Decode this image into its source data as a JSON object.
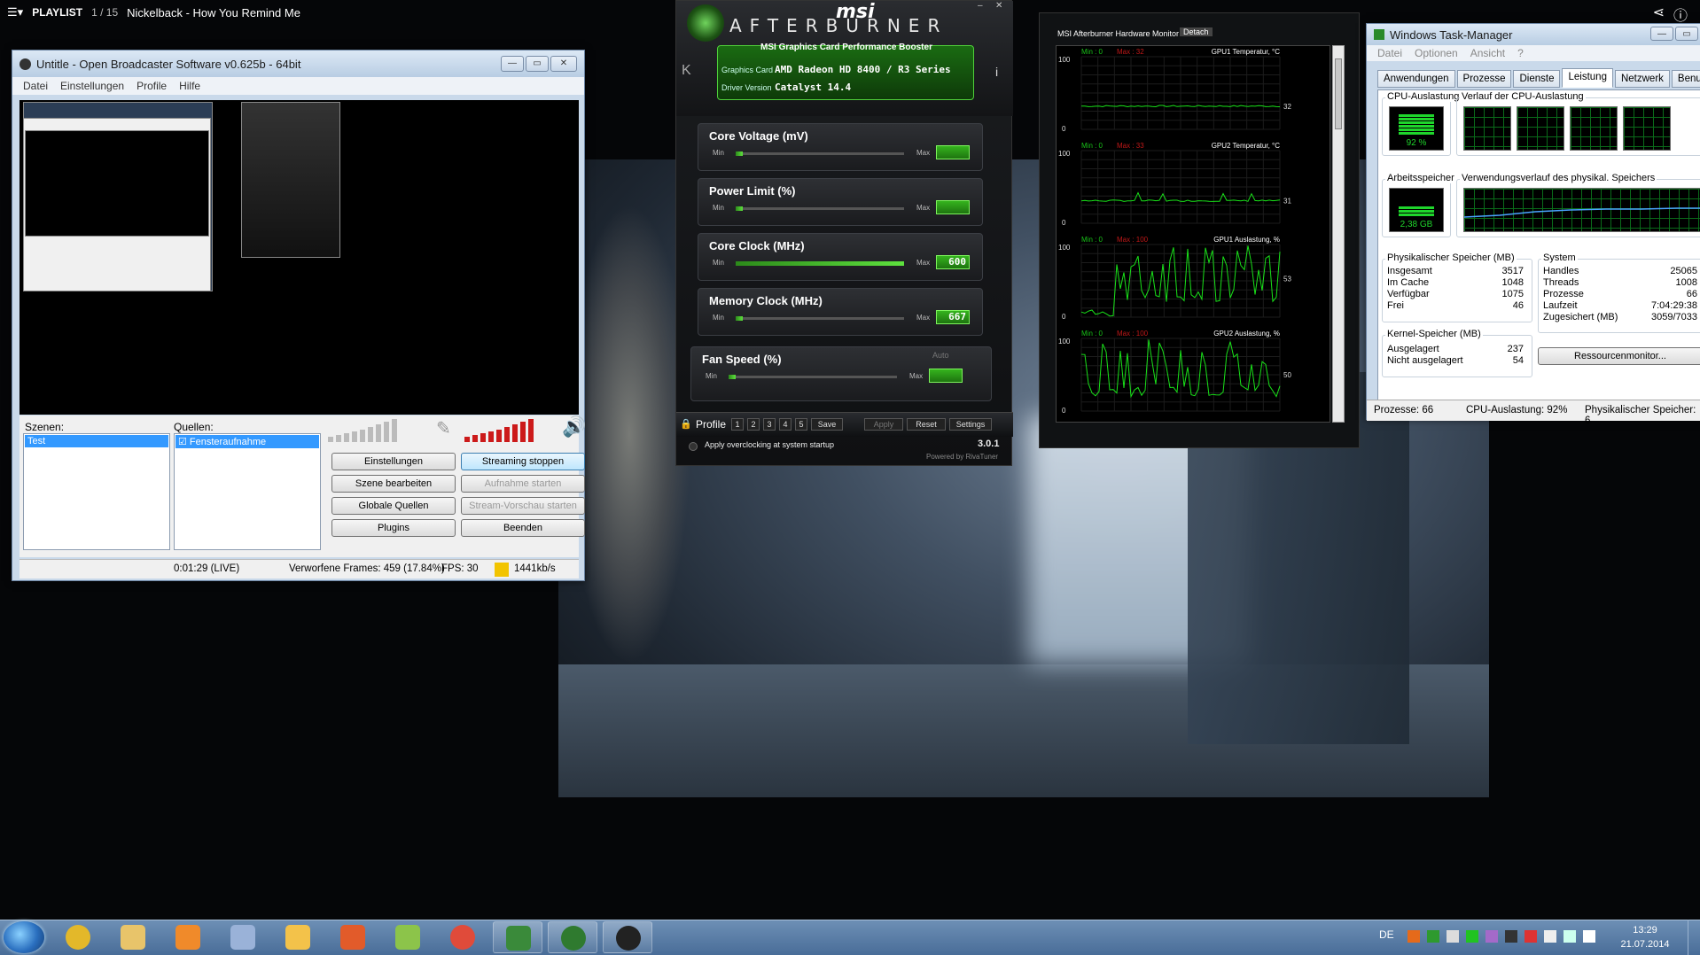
{
  "player": {
    "menu_icon": "hamburger-icon",
    "playlist_label": "PLAYLIST",
    "track_counter": "1 / 15",
    "track_title": "Nickelback - How You Remind Me"
  },
  "obs": {
    "title": "Untitle - Open Broadcaster Software v0.625b - 64bit",
    "menu": [
      "Datei",
      "Einstellungen",
      "Profile",
      "Hilfe"
    ],
    "scenes_label": "Szenen:",
    "sources_label": "Quellen:",
    "scene_selected": "Test",
    "source_selected": "Fensteraufnahme",
    "buttons": {
      "settings": "Einstellungen",
      "stop_stream": "Streaming stoppen",
      "edit_scene": "Szene bearbeiten",
      "start_recording": "Aufnahme starten",
      "global_sources": "Globale Quellen",
      "start_preview": "Stream-Vorschau starten",
      "plugins": "Plugins",
      "exit": "Beenden"
    },
    "status": {
      "time": "0:01:29 (LIVE)",
      "dropped_frames": "Verworfene Frames: 459 (17.84%)",
      "fps": "FPS: 30",
      "bitrate": "1441kb/s"
    },
    "colors": {
      "stream_indicator": "#f2c400",
      "volume_red": "#cc1a1a"
    }
  },
  "afterburner": {
    "logo": "msi",
    "brand": "AFTERBURNER",
    "subtitle": "MSI Graphics Card Performance Booster",
    "graphics_card_label": "Graphics Card",
    "graphics_card": "AMD Radeon HD 8400 / R3 Series",
    "driver_label": "Driver Version",
    "driver": "Catalyst 14.4",
    "min_label": "Min",
    "max_label": "Max",
    "sliders": [
      {
        "name": "Core Voltage (mV)",
        "value": "",
        "level": 0.0
      },
      {
        "name": "Power Limit (%)",
        "value": "",
        "level": 0.0
      },
      {
        "name": "Core Clock (MHz)",
        "value": "600",
        "level": 1.0
      },
      {
        "name": "Memory Clock (MHz)",
        "value": "667",
        "level": 0.0
      },
      {
        "name": "Fan Speed (%)",
        "value": "",
        "level": 0.0
      }
    ],
    "fan_auto": "Auto",
    "profile_label": "Profile",
    "profile_slots": [
      "1",
      "2",
      "3",
      "4",
      "5"
    ],
    "save": "Save",
    "apply": "Apply",
    "reset": "Reset",
    "settings": "Settings",
    "startup_text": "Apply overclocking at system startup",
    "version": "3.0.1",
    "powered_by": "Powered by RivaTuner"
  },
  "hw_monitor": {
    "title": "MSI Afterburner Hardware Monitor",
    "detach": "Detach",
    "graphs": [
      {
        "name": "GPU1 Temperatur, °C",
        "min": "Min : 0",
        "max": "Max : 32",
        "top": "100",
        "bottom": "0",
        "current": "32"
      },
      {
        "name": "GPU2 Temperatur, °C",
        "min": "Min : 0",
        "max": "Max : 33",
        "top": "100",
        "bottom": "0",
        "current": "31"
      },
      {
        "name": "GPU1 Auslastung, %",
        "min": "Min : 0",
        "max": "Max : 100",
        "top": "100",
        "bottom": "0",
        "current": "53"
      },
      {
        "name": "GPU2 Auslastung, %",
        "min": "Min : 0",
        "max": "Max : 100",
        "top": "100",
        "bottom": "0",
        "current": "50"
      }
    ]
  },
  "taskmgr": {
    "title": "Windows Task-Manager",
    "menu": [
      "Datei",
      "Optionen",
      "Ansicht",
      "?"
    ],
    "tabs": [
      "Anwendungen",
      "Prozesse",
      "Dienste",
      "Leistung",
      "Netzwerk",
      "Benutzer"
    ],
    "active_tab": "Leistung",
    "cpu_usage_label": "CPU-Auslastung",
    "cpu_history_label": "Verlauf der CPU-Auslastung",
    "cpu_value": "92 %",
    "memory_label": "Arbeitsspeicher",
    "memory_history_label": "Verwendungsverlauf des physikal. Speichers",
    "memory_value": "2,38 GB",
    "physical": {
      "title": "Physikalischer Speicher (MB)",
      "rows": [
        [
          "Insgesamt",
          "3517"
        ],
        [
          "Im Cache",
          "1048"
        ],
        [
          "Verfügbar",
          "1075"
        ],
        [
          "Frei",
          "46"
        ]
      ]
    },
    "system": {
      "title": "System",
      "rows": [
        [
          "Handles",
          "25065"
        ],
        [
          "Threads",
          "1008"
        ],
        [
          "Prozesse",
          "66"
        ],
        [
          "Laufzeit",
          "7:04:29:38"
        ],
        [
          "Zugesichert (MB)",
          "3059/7033"
        ]
      ]
    },
    "kernel": {
      "title": "Kernel-Speicher (MB)",
      "rows": [
        [
          "Ausgelagert",
          "237"
        ],
        [
          "Nicht ausgelagert",
          "54"
        ]
      ]
    },
    "resource_monitor": "Ressourcenmonitor...",
    "status": {
      "processes": "Prozesse: 66",
      "cpu": "CPU-Auslastung: 92%",
      "memory": "Physikalischer Speicher: 6"
    }
  },
  "taskbar": {
    "apps": [
      "chrome-icon",
      "explorer-icon",
      "media-player-icon",
      "calculator-icon",
      "mail-icon",
      "presentation-icon",
      "pen-icon",
      "picasa-icon",
      "tree-tool-icon",
      "afterburner-icon",
      "obs-icon"
    ],
    "language": "DE",
    "time": "13:29",
    "date": "21.07.2014"
  }
}
